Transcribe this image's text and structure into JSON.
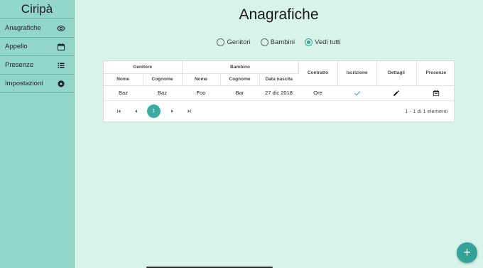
{
  "colors": {
    "accent": "#3aada2",
    "sidebar": "#92d5cb",
    "background": "#d8f3ea"
  },
  "sidebar": {
    "brand": "Ciripà",
    "items": [
      {
        "label": "Anagrafiche",
        "icon": "eye-icon"
      },
      {
        "label": "Appello",
        "icon": "calendar-icon"
      },
      {
        "label": "Presenze",
        "icon": "list-icon"
      },
      {
        "label": "Impostazioni",
        "icon": "gear-icon"
      }
    ]
  },
  "main": {
    "title": "Anagrafiche",
    "filters": {
      "options": [
        "Genitori",
        "Bambini",
        "Vedi tutti"
      ],
      "selected": "Vedi tutti"
    },
    "table": {
      "group_headers": [
        "Genitore",
        "Bambino"
      ],
      "columns": [
        "Nome",
        "Cognome",
        "Nome",
        "Cognome",
        "Data nascita",
        "Contratto",
        "Iscrizione",
        "Dettagli",
        "Presenze"
      ],
      "rows": [
        {
          "genitore_nome": "Baz",
          "genitore_cognome": "Baz",
          "bambino_nome": "Foo",
          "bambino_cognome": "Bar",
          "data_nascita": "27 dic 2018",
          "contratto": "Ore",
          "iscrizione": "check-icon",
          "dettagli": "edit-icon",
          "presenze": "calendar-icon"
        }
      ]
    },
    "pagination": {
      "current_page": "1",
      "range_text": "1 - 1 di 1 elementi"
    }
  },
  "fab": {
    "icon": "plus-icon",
    "label": "+"
  }
}
